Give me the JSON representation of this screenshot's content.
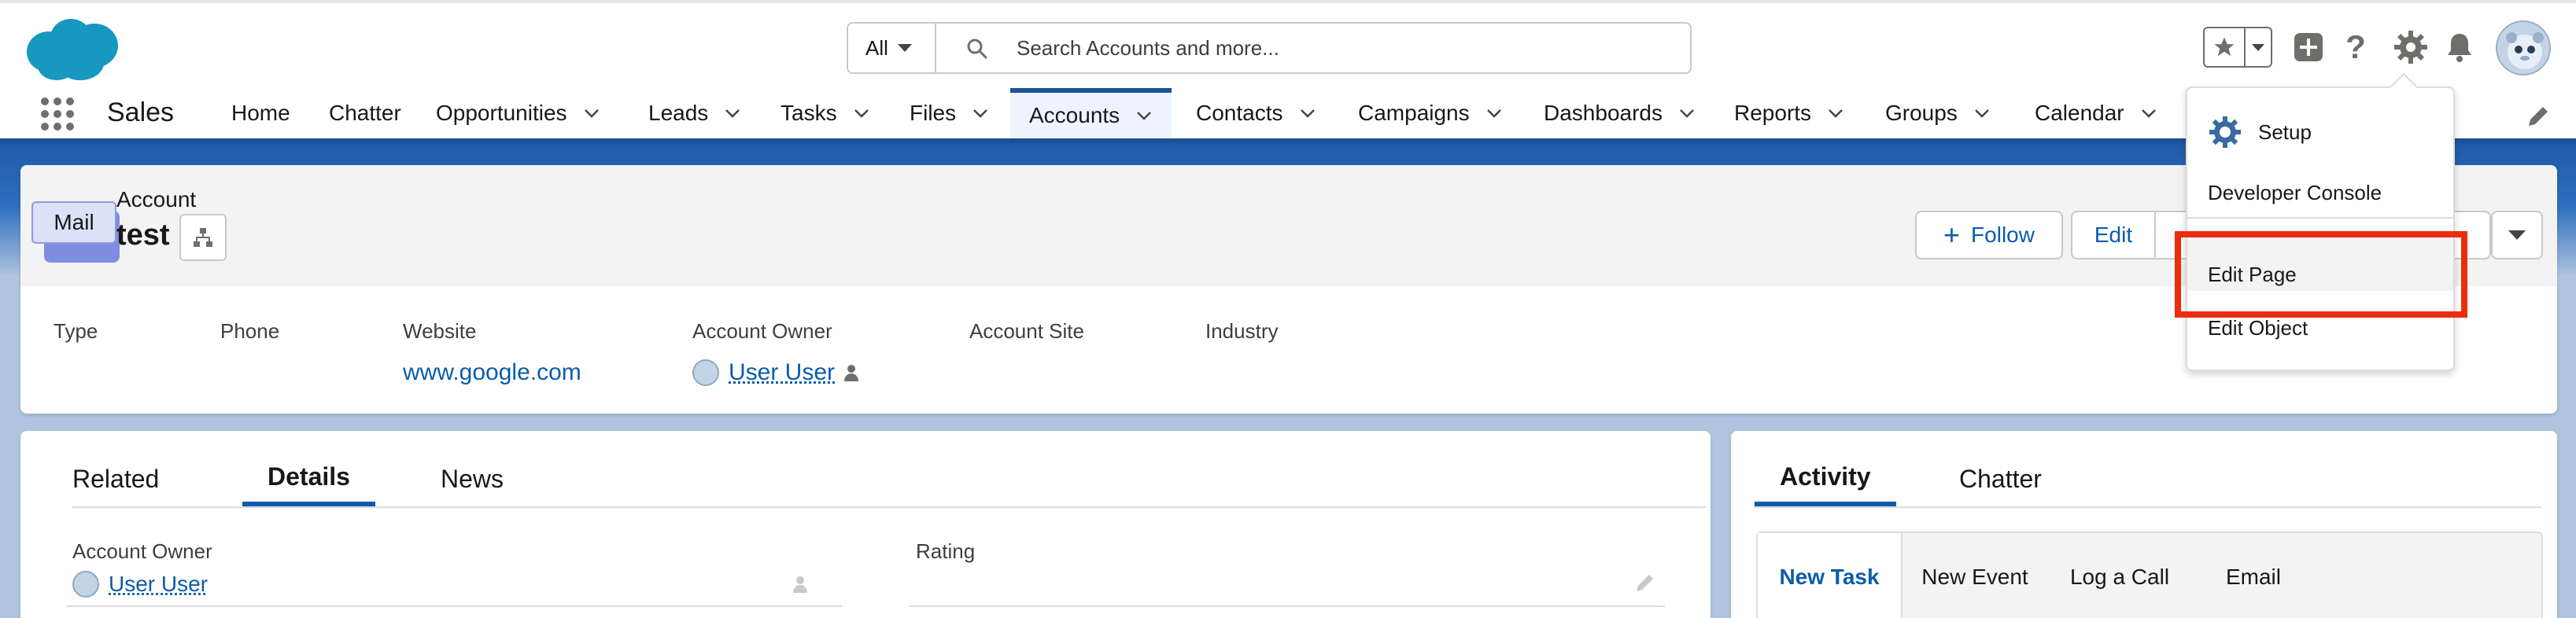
{
  "header": {
    "search": {
      "scope": "All",
      "placeholder": "Search Accounts and more..."
    }
  },
  "nav": {
    "app_name": "Sales",
    "items": [
      {
        "label": "Home",
        "has_menu": false
      },
      {
        "label": "Chatter",
        "has_menu": false
      },
      {
        "label": "Opportunities",
        "has_menu": true
      },
      {
        "label": "Leads",
        "has_menu": true
      },
      {
        "label": "Tasks",
        "has_menu": true
      },
      {
        "label": "Files",
        "has_menu": true
      },
      {
        "label": "Accounts",
        "has_menu": true,
        "active": true
      },
      {
        "label": "Contacts",
        "has_menu": true
      },
      {
        "label": "Campaigns",
        "has_menu": true
      },
      {
        "label": "Dashboards",
        "has_menu": true
      },
      {
        "label": "Reports",
        "has_menu": true
      },
      {
        "label": "Groups",
        "has_menu": true
      },
      {
        "label": "Calendar",
        "has_menu": true
      }
    ]
  },
  "record": {
    "badge": "Mail",
    "type": "Account",
    "name": "test",
    "actions": {
      "follow": "Follow",
      "edit": "Edit"
    },
    "highlights": [
      {
        "label": "Type",
        "value": ""
      },
      {
        "label": "Phone",
        "value": ""
      },
      {
        "label": "Website",
        "value": "www.google.com"
      },
      {
        "label": "Account Owner",
        "value": "User User"
      },
      {
        "label": "Account Site",
        "value": ""
      },
      {
        "label": "Industry",
        "value": ""
      }
    ]
  },
  "detail": {
    "tabs": [
      "Related",
      "Details",
      "News"
    ],
    "active_tab": "Details",
    "fields": [
      {
        "label": "Account Owner",
        "value": "User User"
      },
      {
        "label": "Rating",
        "value": ""
      }
    ]
  },
  "activity": {
    "tabs": [
      "Activity",
      "Chatter"
    ],
    "active_tab": "Activity",
    "sub_tabs": [
      "New Task",
      "New Event",
      "Log a Call",
      "Email"
    ],
    "active_sub_tab": "New Task"
  },
  "setup_menu": {
    "items": [
      "Setup",
      "Developer Console",
      "Edit Page",
      "Edit Object"
    ],
    "highlighted": "Edit Page"
  },
  "colors": {
    "brand_blue": "#1b5297",
    "link_blue": "#0b5cab",
    "highlight_red": "#ea2c0f",
    "account_icon": "#7f8de1"
  }
}
